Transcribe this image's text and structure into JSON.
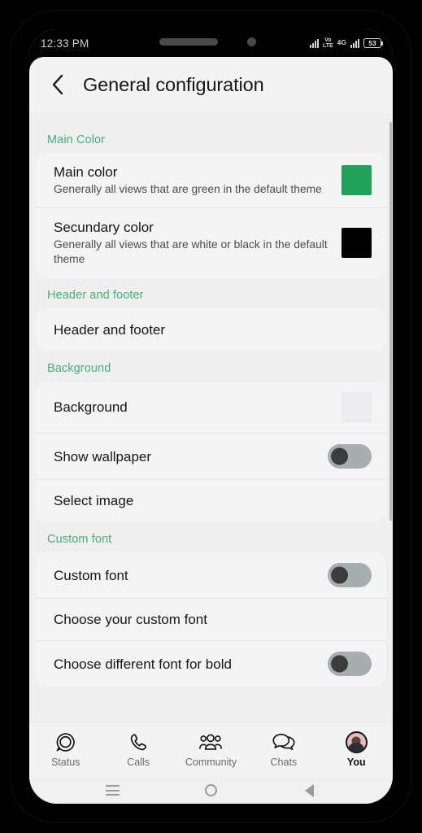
{
  "status_bar": {
    "clock": "12:33 PM",
    "volte_top": "Vo",
    "volte_bottom": "LTE",
    "network": "4G",
    "battery": "53",
    "icons": [
      "signal-bars-icon",
      "volte-icon",
      "4g-icon",
      "signal-bars-icon",
      "battery-icon"
    ]
  },
  "header": {
    "back_icon": "chevron-left-icon",
    "title": "General configuration"
  },
  "sections": [
    {
      "title": "Main Color",
      "rows": [
        {
          "title": "Main color",
          "subtitle": "Generally all views that are green in the default theme",
          "control": "swatch",
          "color": "#21A15C"
        },
        {
          "title": "Secundary color",
          "subtitle": "Generally all views that are white or black in the default theme",
          "control": "swatch",
          "color": "#000000"
        }
      ]
    },
    {
      "title": "Header and footer",
      "rows": [
        {
          "title": "Header and footer",
          "subtitle": "",
          "control": "none"
        }
      ]
    },
    {
      "title": "Background",
      "rows": [
        {
          "title": "Background",
          "subtitle": "",
          "control": "swatch",
          "color": "#EDEDEF"
        },
        {
          "title": "Show wallpaper",
          "subtitle": "",
          "control": "toggle",
          "toggle_state": "off"
        },
        {
          "title": "Select image",
          "subtitle": "",
          "control": "none"
        }
      ]
    },
    {
      "title": "Custom font",
      "rows": [
        {
          "title": "Custom font",
          "subtitle": "",
          "control": "toggle",
          "toggle_state": "off"
        },
        {
          "title": "Choose your custom font",
          "subtitle": "",
          "control": "none"
        },
        {
          "title": "Choose different font for bold",
          "subtitle": "",
          "control": "toggle",
          "toggle_state": "off"
        }
      ]
    }
  ],
  "bottom_nav": {
    "items": [
      {
        "label": "Status",
        "icon": "status-ring-icon",
        "active": false
      },
      {
        "label": "Calls",
        "icon": "phone-icon",
        "active": false
      },
      {
        "label": "Community",
        "icon": "community-people-icon",
        "active": false
      },
      {
        "label": "Chats",
        "icon": "chat-bubbles-icon",
        "active": false
      },
      {
        "label": "You",
        "icon": "avatar-icon",
        "active": true
      }
    ]
  },
  "system_nav": {
    "items": [
      {
        "icon": "recents-hamburger-icon"
      },
      {
        "icon": "home-circle-icon"
      },
      {
        "icon": "back-triangle-icon"
      }
    ]
  },
  "colors": {
    "accent_green": "#43B07A",
    "main_color_swatch": "#21A15C",
    "secondary_color_swatch": "#000000",
    "page_background": "#EFEFEF",
    "card_background": "#F4F4F4"
  }
}
